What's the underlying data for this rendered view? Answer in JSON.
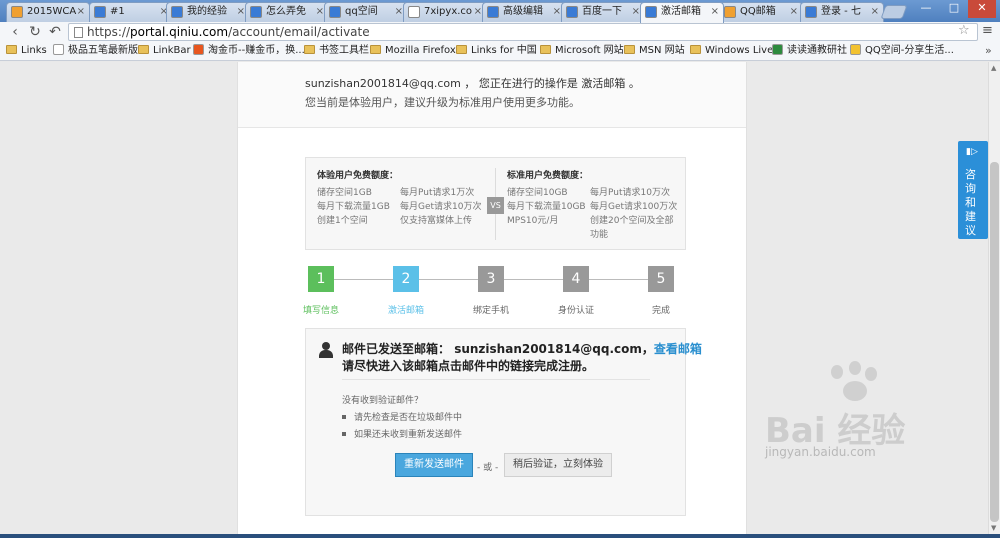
{
  "browser": {
    "tabs": [
      {
        "label": "2015WCA",
        "color": "#f0a030"
      },
      {
        "label": "#1",
        "color": "#3a7bd5"
      },
      {
        "label": "我的经验",
        "color": "#3a7bd5"
      },
      {
        "label": "怎么弄免",
        "color": "#3a7bd5"
      },
      {
        "label": "qq空间",
        "color": "#3a7bd5"
      },
      {
        "label": "7xipyx.co",
        "color": "#ffffff"
      },
      {
        "label": "高级编辑",
        "color": "#3a7bd5"
      },
      {
        "label": "百度一下",
        "color": "#3a7bd5"
      },
      {
        "label": "激活邮箱",
        "color": "#3a7bd5"
      },
      {
        "label": "QQ邮箱",
        "color": "#f0a030"
      },
      {
        "label": "登录 - 七",
        "color": "#3a7bd5"
      }
    ],
    "active_tab_index": 8,
    "url_scheme": "https://",
    "url_host": "portal.qiniu.com",
    "url_path": "/account/email/activate",
    "bookmarks": [
      {
        "label": "Links",
        "icon": "folder"
      },
      {
        "label": "极品五笔最新版",
        "icon": "page"
      },
      {
        "label": "LinkBar",
        "icon": "folder"
      },
      {
        "label": "淘金币--赚金币，换...",
        "icon": "taobao"
      },
      {
        "label": "书签工具栏",
        "icon": "folder"
      },
      {
        "label": "Mozilla Firefox",
        "icon": "folder"
      },
      {
        "label": "Links for 中国",
        "icon": "folder"
      },
      {
        "label": "Microsoft 网站",
        "icon": "folder"
      },
      {
        "label": "MSN 网站",
        "icon": "folder"
      },
      {
        "label": "Windows Live",
        "icon": "folder"
      },
      {
        "label": "读读通教研社",
        "icon": "green"
      },
      {
        "label": "QQ空间-分享生活...",
        "icon": "star"
      }
    ],
    "bookmarks_more": "»"
  },
  "header": {
    "email": "sunzishan2001814@qq.com",
    "op_prefix": "，  您正在进行的操作是",
    "op_name": "激活邮箱",
    "op_suffix": "。",
    "trial_notice": "您当前是体验用户，建议升级为标准用户使用更多功能。"
  },
  "quota": {
    "trial_title": "体验用户免费额度：",
    "trial_col1": [
      "储存空间1GB",
      "每月下载流量1GB",
      "创建1个空间"
    ],
    "trial_col2": [
      "每月Put请求1万次",
      "每月Get请求10万次",
      "仅支持富媒体上传"
    ],
    "vs": "VS",
    "std_title": "标准用户免费额度：",
    "std_col1": [
      "储存空间10GB",
      "每月下载流量10GB",
      "MPS10元/月"
    ],
    "std_col2": [
      "每月Put请求10万次",
      "每月Get请求100万次",
      "创建20个空间及全部",
      "功能"
    ]
  },
  "steps": [
    {
      "num": "1",
      "label": "填写信息",
      "state": "done",
      "color": "#5cbf5c",
      "label_color": "#5cbf5c"
    },
    {
      "num": "2",
      "label": "激活邮箱",
      "state": "current",
      "color": "#5bc0e8",
      "label_color": "#5bc0e8"
    },
    {
      "num": "3",
      "label": "绑定手机",
      "state": "todo",
      "color": "#999999",
      "label_color": "#666666"
    },
    {
      "num": "4",
      "label": "身份认证",
      "state": "todo",
      "color": "#999999",
      "label_color": "#666666"
    },
    {
      "num": "5",
      "label": "完成",
      "state": "todo",
      "color": "#999999",
      "label_color": "#666666"
    }
  ],
  "mail": {
    "sent_prefix": "邮件已发送至邮箱：",
    "sent_email": "sunzishan2001814@qq.com",
    "sent_comma": "，",
    "check_link": "查看邮箱",
    "instruction": "请尽快进入该邮箱点击邮件中的链接完成注册。",
    "no_receive": "没有收到验证邮件？",
    "tips": [
      "请先检查是否在垃圾邮件中",
      "如果还未收到重新发送邮件"
    ],
    "resend_btn": "重新发送邮件",
    "or": "- 或 -",
    "later_btn": "稍后验证，立刻体验"
  },
  "feedback": {
    "label": "咨询和建议"
  },
  "watermark": {
    "text": "Bai 经验",
    "url": "jingyan.baidu.com"
  }
}
